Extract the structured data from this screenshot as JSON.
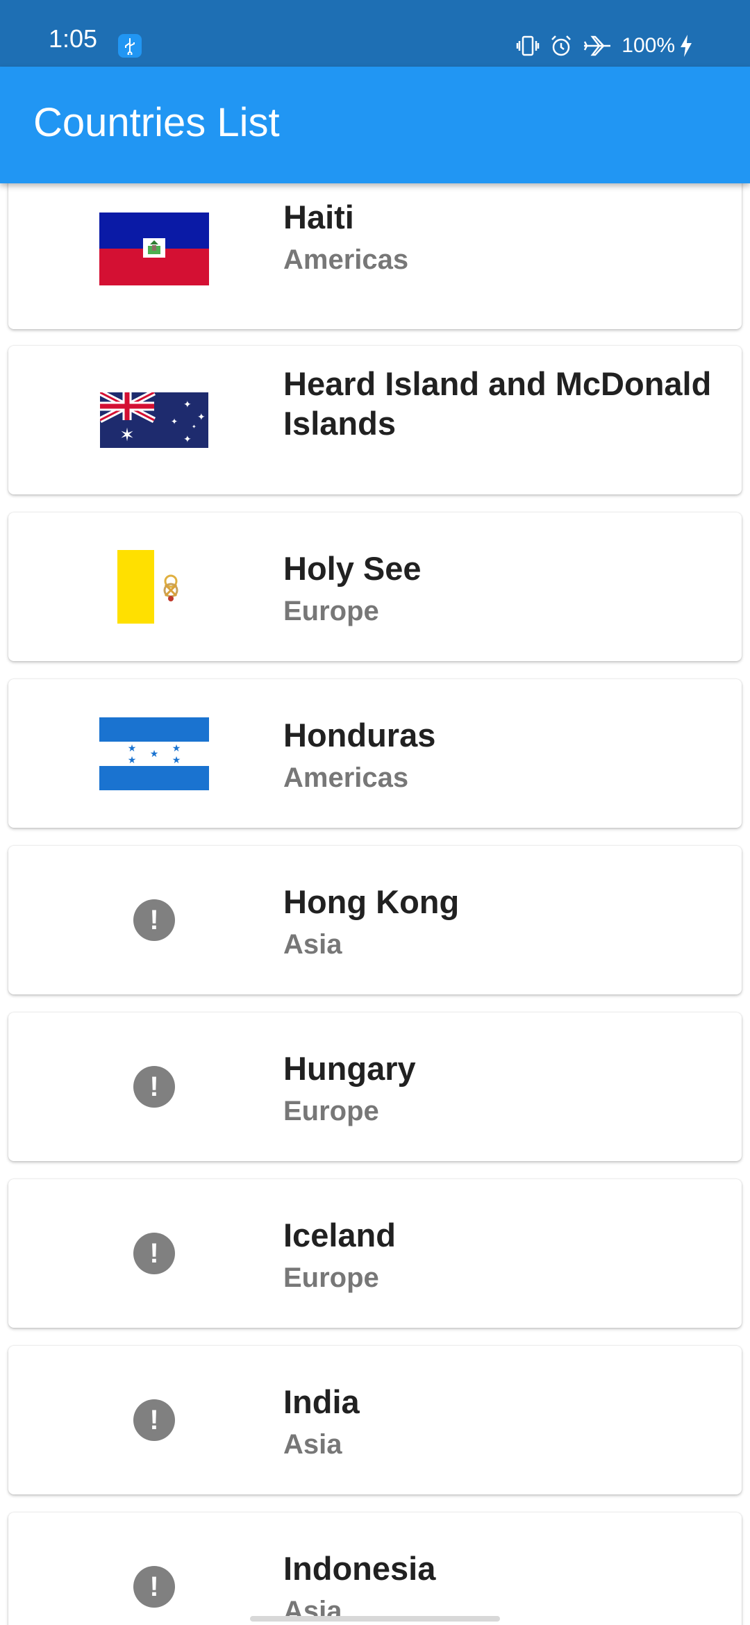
{
  "status_bar": {
    "time": "1:05",
    "battery_percent": "100%",
    "icons": [
      "usb-icon",
      "vibrate-icon",
      "alarm-icon",
      "airplane-mode-icon",
      "charging-icon"
    ]
  },
  "app_bar": {
    "title": "Countries List"
  },
  "countries": [
    {
      "name": "Haiti",
      "region": "Americas",
      "flag": "haiti-flag"
    },
    {
      "name": "Heard Island and McDonald Islands",
      "region": "",
      "flag": "australia-flag"
    },
    {
      "name": "Holy See",
      "region": "Europe",
      "flag": "holy-see-flag"
    },
    {
      "name": "Honduras",
      "region": "Americas",
      "flag": "honduras-flag"
    },
    {
      "name": "Hong Kong",
      "region": "Asia",
      "flag": "alert-icon"
    },
    {
      "name": "Hungary",
      "region": "Europe",
      "flag": "alert-icon"
    },
    {
      "name": "Iceland",
      "region": "Europe",
      "flag": "alert-icon"
    },
    {
      "name": "India",
      "region": "Asia",
      "flag": "alert-icon"
    },
    {
      "name": "Indonesia",
      "region": "Asia",
      "flag": "alert-icon"
    }
  ],
  "placeholder_icon_glyph": "!",
  "colors": {
    "status_bar": "#1e6fb4",
    "app_bar": "#2196f3",
    "name_text": "#212121",
    "region_text": "#777777",
    "placeholder_icon": "#808080"
  }
}
